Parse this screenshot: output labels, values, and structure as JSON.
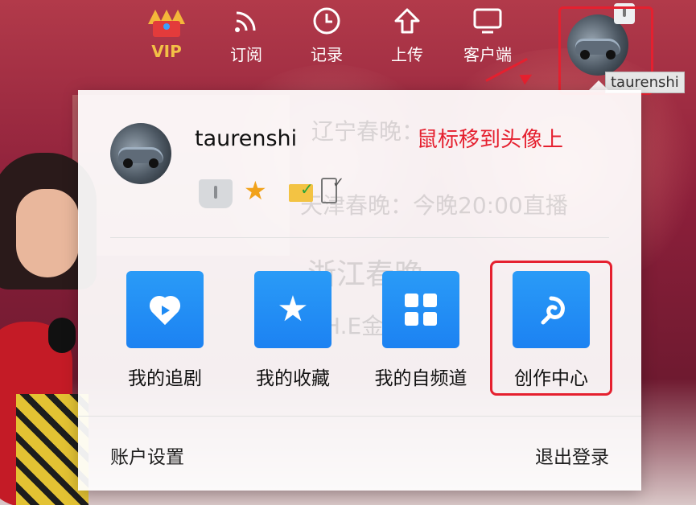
{
  "topnav": {
    "items": [
      {
        "label": "VIP",
        "icon": "crown-icon"
      },
      {
        "label": "订阅",
        "icon": "rss-icon"
      },
      {
        "label": "记录",
        "icon": "clock-icon"
      },
      {
        "label": "上传",
        "icon": "upload-icon"
      },
      {
        "label": "客户端",
        "icon": "monitor-icon"
      }
    ],
    "vip_color": "#f3c046",
    "avatar_tooltip": "taurenshi"
  },
  "panel": {
    "username": "taurenshi",
    "annotation": "鼠标移到头像上",
    "status_icons": [
      "level-bag-icon",
      "star-badge-icon",
      "mail-verified-icon",
      "phone-verified-icon"
    ],
    "tiles": [
      {
        "label": "我的追剧",
        "icon": "heart-play-icon"
      },
      {
        "label": "我的收藏",
        "icon": "star-icon"
      },
      {
        "label": "我的自频道",
        "icon": "grid-icon"
      },
      {
        "label": "创作中心",
        "icon": "swirl-icon"
      }
    ],
    "footer": {
      "left": "账户设置",
      "right": "退出登录"
    }
  },
  "background_text": [
    "辽宁春晚：",
    "天津春晚：今晚20:00直播",
    "浙江春晚",
    "H.E金"
  ],
  "colors": {
    "accent": "#1f8bf4",
    "highlight": "#e5202f"
  }
}
